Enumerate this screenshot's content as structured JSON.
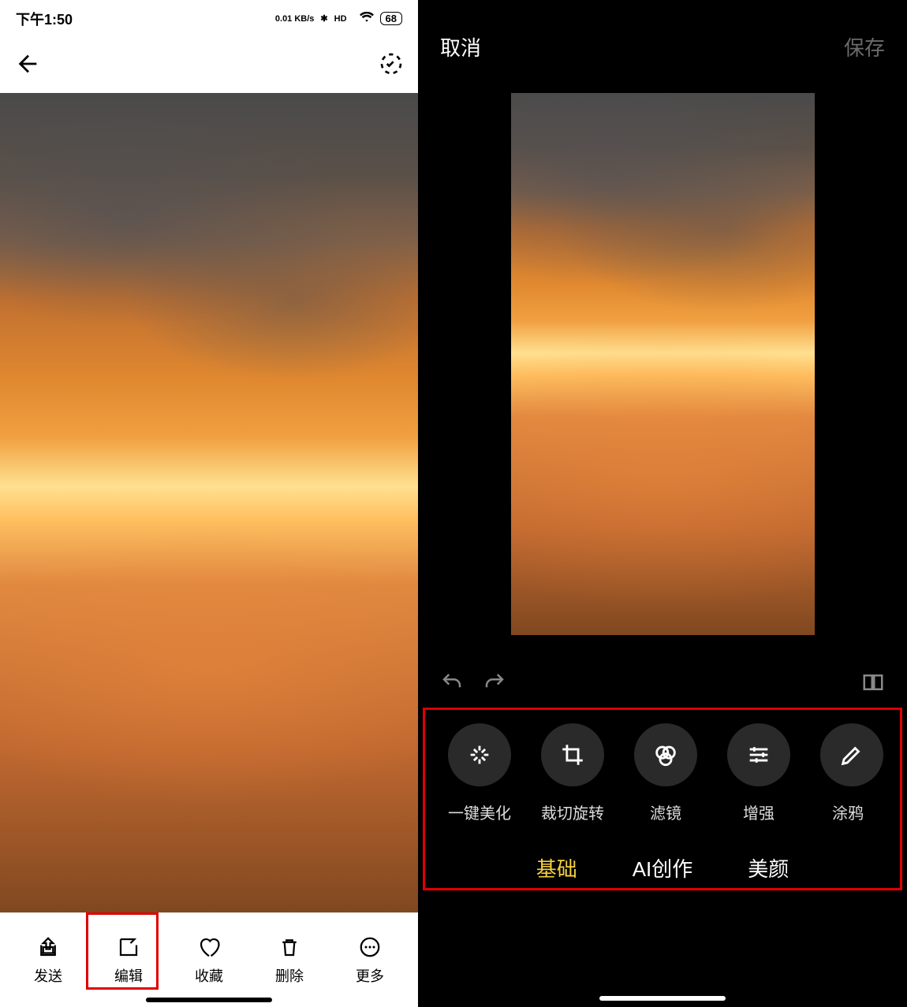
{
  "status_bar": {
    "time": "下午1:50",
    "net_speed": "0.01 KB/s",
    "hd": "HD",
    "battery": "68"
  },
  "left_toolbar": {
    "send": "发送",
    "edit": "编辑",
    "favorite": "收藏",
    "delete": "删除",
    "more": "更多"
  },
  "editor": {
    "cancel": "取消",
    "save": "保存"
  },
  "edit_tools": {
    "auto_beautify": "一键美化",
    "crop_rotate": "裁切旋转",
    "filter": "滤镜",
    "enhance": "增强",
    "doodle": "涂鸦"
  },
  "tabs": {
    "basic": "基础",
    "ai_create": "AI创作",
    "beauty": "美颜"
  }
}
